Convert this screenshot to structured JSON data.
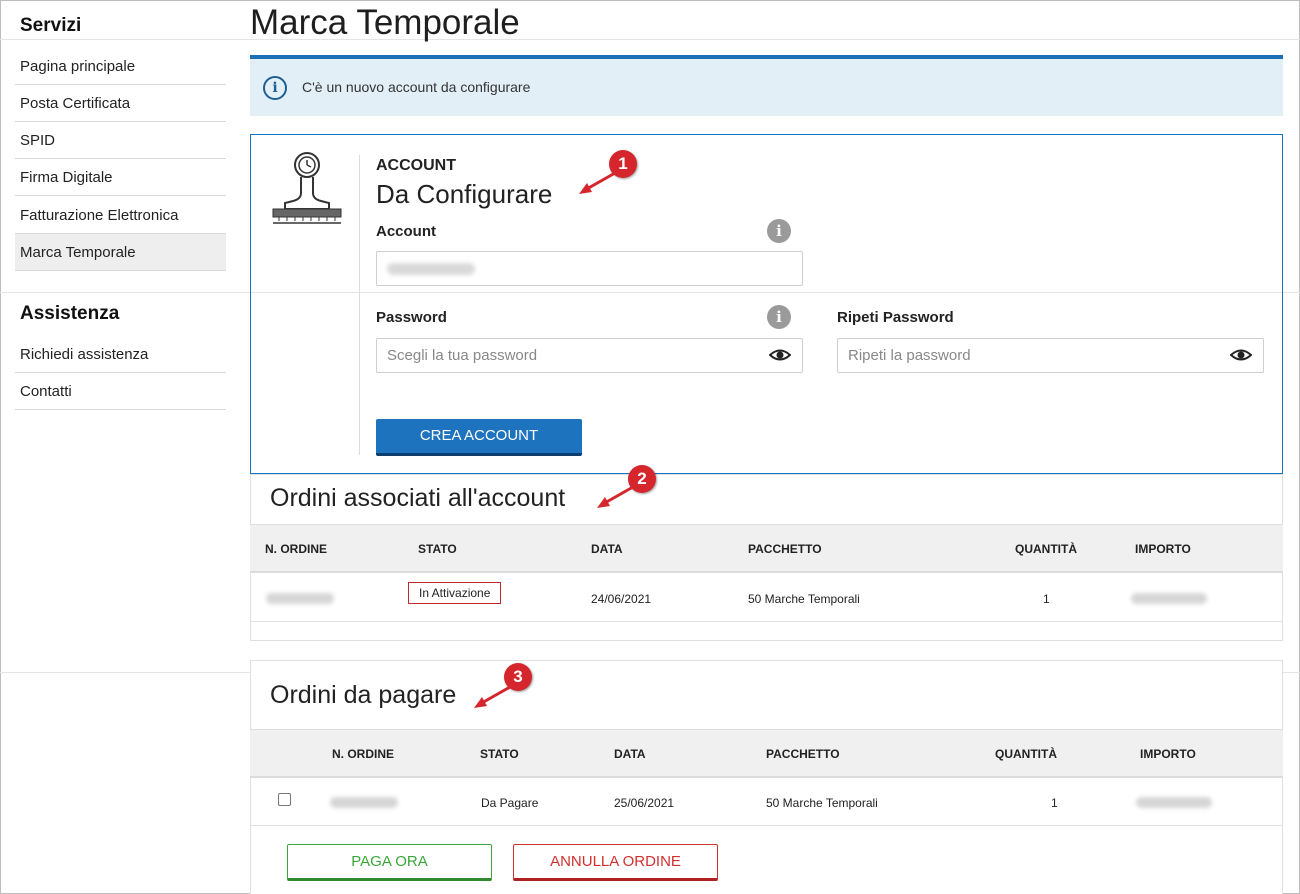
{
  "sidebar": {
    "services_heading": "Servizi",
    "items": [
      {
        "label": "Pagina principale"
      },
      {
        "label": "Posta Certificata"
      },
      {
        "label": "SPID"
      },
      {
        "label": "Firma Digitale"
      },
      {
        "label": "Fatturazione Elettronica"
      },
      {
        "label": "Marca Temporale",
        "active": true
      }
    ],
    "support_heading": "Assistenza",
    "support_items": [
      {
        "label": "Richiedi assistenza"
      },
      {
        "label": "Contatti"
      }
    ]
  },
  "page": {
    "title": "Marca Temporale",
    "info_message": "C'è un nuovo account da configurare"
  },
  "account": {
    "label": "ACCOUNT",
    "status": "Da Configurare",
    "account_field_label": "Account",
    "password_field_label": "Password",
    "password_placeholder": "Scegli la tua password",
    "repeat_password_label": "Ripeti Password",
    "repeat_password_placeholder": "Ripeti la password",
    "create_button": "CREA ACCOUNT"
  },
  "associated_orders": {
    "title": "Ordini associati all'account",
    "columns": [
      "N. ORDINE",
      "STATO",
      "DATA",
      "PACCHETTO",
      "QUANTITÀ",
      "IMPORTO"
    ],
    "rows": [
      {
        "status": "In Attivazione",
        "date": "24/06/2021",
        "package": "50 Marche Temporali",
        "quantity": "1"
      }
    ]
  },
  "orders_to_pay": {
    "title": "Ordini da pagare",
    "columns": [
      "N. ORDINE",
      "STATO",
      "DATA",
      "PACCHETTO",
      "QUANTITÀ",
      "IMPORTO"
    ],
    "rows": [
      {
        "status": "Da Pagare",
        "date": "25/06/2021",
        "package": "50 Marche Temporali",
        "quantity": "1"
      }
    ],
    "pay_button": "PAGA ORA",
    "cancel_button": "ANNULLA ORDINE"
  },
  "callouts": [
    "1",
    "2",
    "3"
  ],
  "colors": {
    "accent_blue": "#1e73be",
    "banner_bg": "#e3eff7",
    "callout_red": "#d4262c",
    "pay_green": "#3aa63a",
    "cancel_red": "#d0302f"
  },
  "icons": [
    "info-icon",
    "timestamp-stamp-icon",
    "help-icon",
    "eye-icon",
    "arrow-icon"
  ]
}
